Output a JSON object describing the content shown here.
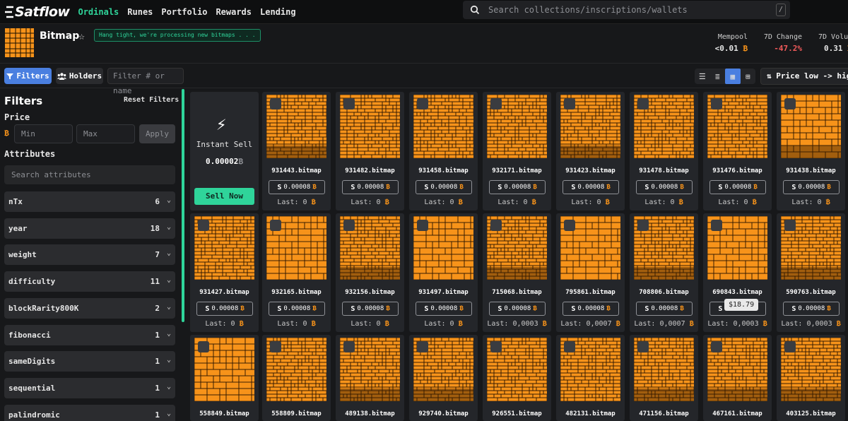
{
  "brand": {
    "name": "Satflow",
    "accent": "#2fd49a",
    "btc_color": "#f7931a"
  },
  "nav": {
    "items": [
      "Ordinals",
      "Runes",
      "Portfolio",
      "Rewards",
      "Lending"
    ],
    "active": "Ordinals"
  },
  "search": {
    "placeholder": "Search collections/inscriptions/wallets",
    "shortcut": "/"
  },
  "collection": {
    "name": "Bitmap",
    "notice": "Hang tight, we're processing new bitmaps . . .",
    "stats": [
      {
        "label": "Mempool",
        "value": "<0.01",
        "unit": "₿"
      },
      {
        "label": "7D Change",
        "value": "-47.2%",
        "unit": ""
      },
      {
        "label": "7D Volu",
        "value": "0.31",
        "unit": "₿"
      }
    ]
  },
  "toolbar": {
    "filters_label": "Filters",
    "holders_label": "Holders",
    "filter_placeholder": "Filter # or name",
    "sort_label": "Price low -> high",
    "views": [
      "list-icon",
      "compact-list-icon",
      "grid-icon",
      "large-grid-icon"
    ],
    "active_view": "grid-icon"
  },
  "sidebar": {
    "title": "Filters",
    "reset": "Reset Filters",
    "price_label": "Price",
    "price_currency": "₿",
    "min_placeholder": "Min",
    "max_placeholder": "Max",
    "apply": "Apply",
    "attributes_label": "Attributes",
    "attr_search_placeholder": "Search attributes",
    "attributes": [
      {
        "name": "nTx",
        "count": "6"
      },
      {
        "name": "year",
        "count": "18"
      },
      {
        "name": "weight",
        "count": "7"
      },
      {
        "name": "difficulty",
        "count": "11"
      },
      {
        "name": "blockRarity800K",
        "count": "2"
      },
      {
        "name": "fibonacci",
        "count": "1"
      },
      {
        "name": "sameDigits",
        "count": "1"
      },
      {
        "name": "sequential",
        "count": "1"
      },
      {
        "name": "palindromic",
        "count": "1"
      }
    ]
  },
  "instant_sell": {
    "title": "Instant Sell",
    "value": "0.00002",
    "unit": "₿",
    "button": "Sell Now"
  },
  "price_prefix": "S",
  "last_prefix": "Last: ",
  "items": [
    {
      "name": "931443.bitmap",
      "price": "0.00008",
      "last": "0"
    },
    {
      "name": "931482.bitmap",
      "price": "0.00008",
      "last": "0"
    },
    {
      "name": "931458.bitmap",
      "price": "0.00008",
      "last": "0"
    },
    {
      "name": "932171.bitmap",
      "price": "0.00008",
      "last": "0"
    },
    {
      "name": "931423.bitmap",
      "price": "0.00008",
      "last": "0"
    },
    {
      "name": "931478.bitmap",
      "price": "0.00008",
      "last": "0"
    },
    {
      "name": "931476.bitmap",
      "price": "0.00008",
      "last": "0"
    },
    {
      "name": "931438.bitmap",
      "price": "0.00008",
      "last": "0"
    },
    {
      "name": "931427.bitmap",
      "price": "0.00008",
      "last": "0"
    },
    {
      "name": "932165.bitmap",
      "price": "0.00008",
      "last": "0"
    },
    {
      "name": "932156.bitmap",
      "price": "0.00008",
      "last": "0"
    },
    {
      "name": "931497.bitmap",
      "price": "0.00008",
      "last": "0"
    },
    {
      "name": "715068.bitmap",
      "price": "0.00008",
      "last": "0,0003"
    },
    {
      "name": "795861.bitmap",
      "price": "0.00008",
      "last": "0,0007"
    },
    {
      "name": "708806.bitmap",
      "price": "0.00008",
      "last": "0,0007"
    },
    {
      "name": "690843.bitmap",
      "price": "0.00008",
      "last": "0,0003",
      "tooltip": "$18.79"
    },
    {
      "name": "590763.bitmap",
      "price": "0.00008",
      "last": "0,0003"
    },
    {
      "name": "558849.bitmap",
      "price": "",
      "last": ""
    },
    {
      "name": "558809.bitmap",
      "price": "",
      "last": ""
    },
    {
      "name": "489138.bitmap",
      "price": "",
      "last": ""
    },
    {
      "name": "929740.bitmap",
      "price": "",
      "last": ""
    },
    {
      "name": "926551.bitmap",
      "price": "",
      "last": ""
    },
    {
      "name": "482131.bitmap",
      "price": "",
      "last": ""
    },
    {
      "name": "471156.bitmap",
      "price": "",
      "last": ""
    },
    {
      "name": "467161.bitmap",
      "price": "",
      "last": ""
    },
    {
      "name": "403125.bitmap",
      "price": "",
      "last": ""
    }
  ]
}
